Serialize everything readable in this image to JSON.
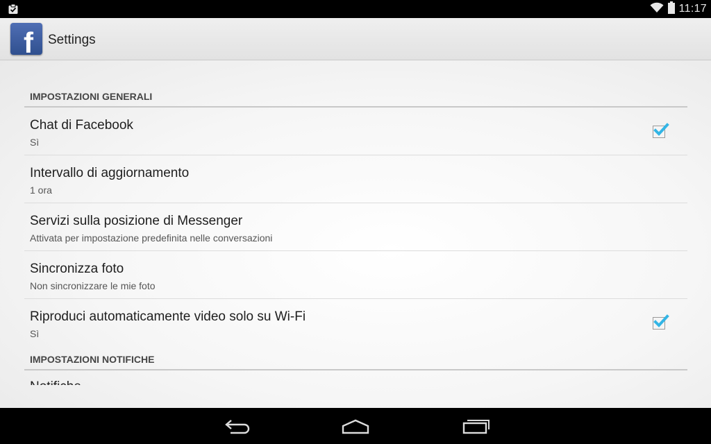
{
  "status_bar": {
    "time": "11:17"
  },
  "action_bar": {
    "title": "Settings",
    "app_icon_letter": "f"
  },
  "sections": [
    {
      "header": "IMPOSTAZIONI GENERALI",
      "items": [
        {
          "title": "Chat di Facebook",
          "summary": "Sì",
          "checked": true
        },
        {
          "title": "Intervallo di aggiornamento",
          "summary": "1 ora"
        },
        {
          "title": "Servizi sulla posizione di Messenger",
          "summary": "Attivata per impostazione predefinita nelle conversazioni"
        },
        {
          "title": "Sincronizza foto",
          "summary": "Non sincronizzare le mie foto"
        },
        {
          "title": "Riproduci automaticamente video solo su Wi-Fi",
          "summary": "Sì",
          "checked": true
        }
      ]
    },
    {
      "header": "IMPOSTAZIONI NOTIFICHE",
      "items": [
        {
          "title": "Notifiche"
        }
      ]
    }
  ],
  "colors": {
    "checkbox_accent": "#33b5e5",
    "facebook_blue": "#3b5998"
  }
}
